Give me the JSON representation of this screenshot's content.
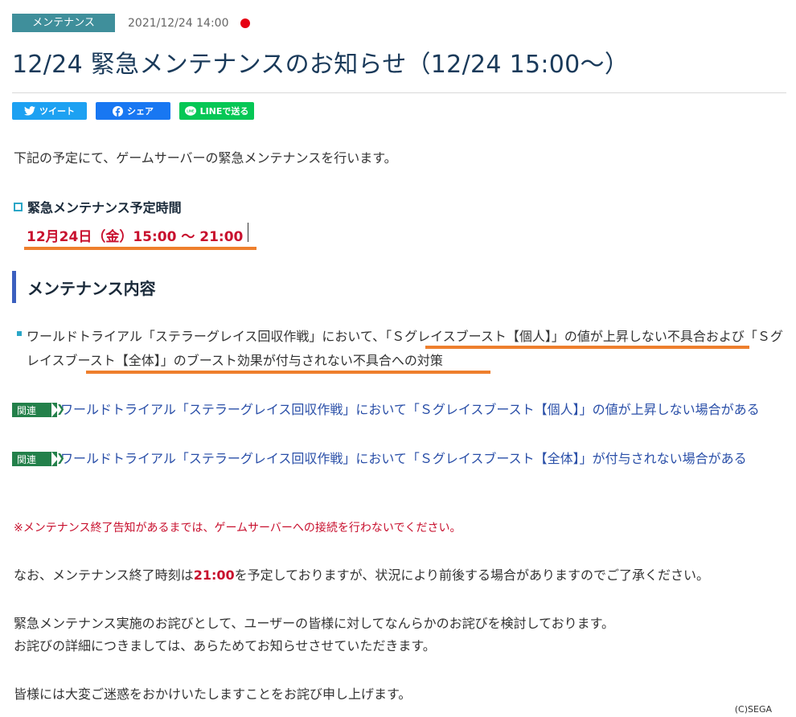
{
  "header": {
    "category": "メンテナンス",
    "date": "2021/12/24 14:00",
    "new_indicator_color": "#e60012"
  },
  "title": "12/24 緊急メンテナンスのお知らせ（12/24 15:00～）",
  "share": {
    "tweet_label": "ツイート",
    "facebook_label": "シェア",
    "line_label": "LINEで送る",
    "line_icon_text": "LINE"
  },
  "intro": "下記の予定にて、ゲームサーバーの緊急メンテナンスを行います。",
  "schedule": {
    "heading": "緊急メンテナンス予定時間",
    "time": "12月24日（金）15:00 ～ 21:00"
  },
  "section": {
    "heading": "メンテナンス内容",
    "items": [
      {
        "part1": "ワールドトライアル「ステラーグレイス回収作戦」において、",
        "highlight1": "「Ｓグレイスブースト【個人】」の値が上昇しない不具",
        "part2": "合および",
        "highlight2": "「Ｓグレイスブースト【全体】」のブースト効果が付与されない",
        "part3": "不具合への対策"
      }
    ]
  },
  "related": {
    "tag": "関連",
    "links": [
      "ワールドトライアル「ステラーグレイス回収作戦」において「Ｓグレイスブースト【個人】」の値が上昇しない場合がある",
      "ワールドトライアル「ステラーグレイス回収作戦」において「Ｓグレイスブースト【全体】」が付与されない場合がある"
    ]
  },
  "notice": "※メンテナンス終了告知があるまでは、ゲームサーバーへの接続を行わないでください。",
  "end_time": {
    "before": "なお、メンテナンス終了時刻は",
    "time": "21:00",
    "after": "を予定しておりますが、状況により前後する場合がありますのでご了承ください。"
  },
  "apology": {
    "line1": "緊急メンテナンス実施のお詫びとして、ユーザーの皆様に対してなんらかのお詫びを検討しております。",
    "line2": "お詫びの詳細につきましては、あらためてお知らせさせていただきます。"
  },
  "closing": "皆様には大変ご迷惑をおかけいたしますことをお詫び申し上げます。",
  "copyright": "(C)SEGA",
  "colors": {
    "accent_orange": "#ee7f2d",
    "emphasis_red": "#c8102e",
    "link_blue": "#2a4fa8",
    "related_green": "#23804a"
  }
}
